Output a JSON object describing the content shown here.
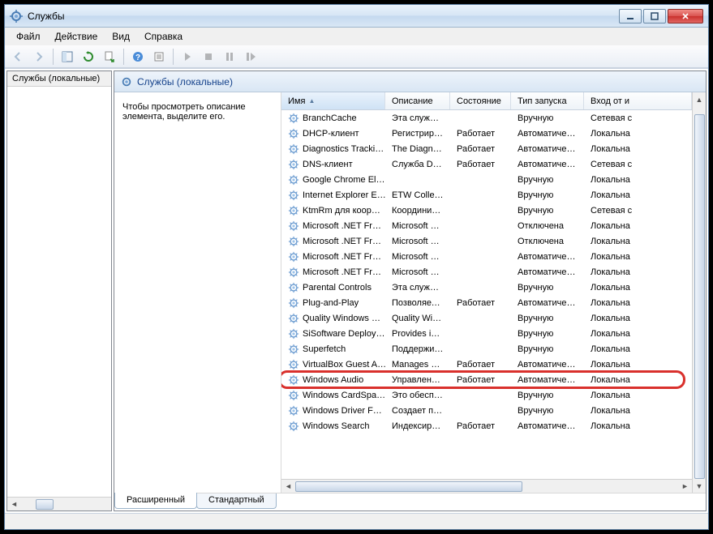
{
  "window": {
    "title": "Службы"
  },
  "menu": {
    "file": "Файл",
    "action": "Действие",
    "view": "Вид",
    "help": "Справка"
  },
  "tree": {
    "root": "Службы (локальные)"
  },
  "pane": {
    "title": "Службы (локальные)",
    "hint": "Чтобы просмотреть описание элемента, выделите его."
  },
  "columns": {
    "name": "Имя",
    "desc": "Описание",
    "state": "Состояние",
    "start": "Тип запуска",
    "logon": "Вход от и"
  },
  "tabs": {
    "extended": "Расширенный",
    "standard": "Стандартный"
  },
  "services": [
    {
      "name": "BranchCache",
      "desc": "Эта служб…",
      "state": "",
      "start": "Вручную",
      "logon": "Сетевая с"
    },
    {
      "name": "DHCP-клиент",
      "desc": "Регистрир…",
      "state": "Работает",
      "start": "Автоматиче…",
      "logon": "Локальна"
    },
    {
      "name": "Diagnostics Tracki…",
      "desc": "The Diagn…",
      "state": "Работает",
      "start": "Автоматиче…",
      "logon": "Локальна"
    },
    {
      "name": "DNS-клиент",
      "desc": "Служба D…",
      "state": "Работает",
      "start": "Автоматиче…",
      "logon": "Сетевая с"
    },
    {
      "name": "Google Chrome El…",
      "desc": "",
      "state": "",
      "start": "Вручную",
      "logon": "Локальна"
    },
    {
      "name": "Internet Explorer E…",
      "desc": "ETW Colle…",
      "state": "",
      "start": "Вручную",
      "logon": "Локальна"
    },
    {
      "name": "KtmRm для коор…",
      "desc": "Координи…",
      "state": "",
      "start": "Вручную",
      "logon": "Сетевая с"
    },
    {
      "name": "Microsoft .NET Fr…",
      "desc": "Microsoft …",
      "state": "",
      "start": "Отключена",
      "logon": "Локальна"
    },
    {
      "name": "Microsoft .NET Fr…",
      "desc": "Microsoft …",
      "state": "",
      "start": "Отключена",
      "logon": "Локальна"
    },
    {
      "name": "Microsoft .NET Fr…",
      "desc": "Microsoft …",
      "state": "",
      "start": "Автоматиче…",
      "logon": "Локальна"
    },
    {
      "name": "Microsoft .NET Fr…",
      "desc": "Microsoft …",
      "state": "",
      "start": "Автоматиче…",
      "logon": "Локальна"
    },
    {
      "name": "Parental Controls",
      "desc": "Эта служб…",
      "state": "",
      "start": "Вручную",
      "logon": "Локальна"
    },
    {
      "name": "Plug-and-Play",
      "desc": "Позволяет…",
      "state": "Работает",
      "start": "Автоматиче…",
      "logon": "Локальна"
    },
    {
      "name": "Quality Windows …",
      "desc": "Quality Wi…",
      "state": "",
      "start": "Вручную",
      "logon": "Локальна"
    },
    {
      "name": "SiSoftware Deploy…",
      "desc": "Provides in…",
      "state": "",
      "start": "Вручную",
      "logon": "Локальна"
    },
    {
      "name": "Superfetch",
      "desc": "Поддержи…",
      "state": "",
      "start": "Вручную",
      "logon": "Локальна"
    },
    {
      "name": "VirtualBox Guest A…",
      "desc": "Manages V…",
      "state": "Работает",
      "start": "Автоматиче…",
      "logon": "Локальна"
    },
    {
      "name": "Windows Audio",
      "desc": "Управлен…",
      "state": "Работает",
      "start": "Автоматиче…",
      "logon": "Локальна",
      "highlighted": true
    },
    {
      "name": "Windows CardSpa…",
      "desc": "Это обесп…",
      "state": "",
      "start": "Вручную",
      "logon": "Локальна"
    },
    {
      "name": "Windows Driver F…",
      "desc": "Создает п…",
      "state": "",
      "start": "Вручную",
      "logon": "Локальна"
    },
    {
      "name": "Windows Search",
      "desc": "Индексир…",
      "state": "Работает",
      "start": "Автоматиче…",
      "logon": "Локальна"
    }
  ]
}
